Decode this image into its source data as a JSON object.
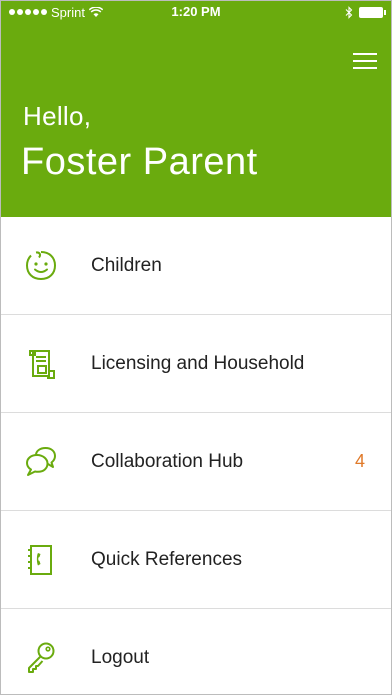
{
  "status_bar": {
    "carrier": "Sprint",
    "time": "1:20 PM"
  },
  "header": {
    "greeting": "Hello,",
    "name": "Foster Parent"
  },
  "menu": {
    "items": [
      {
        "label": "Children",
        "icon": "child-face-icon",
        "badge": ""
      },
      {
        "label": "Licensing and Household",
        "icon": "document-scroll-icon",
        "badge": ""
      },
      {
        "label": "Collaboration Hub",
        "icon": "chat-bubbles-icon",
        "badge": "4"
      },
      {
        "label": "Quick References",
        "icon": "phone-book-icon",
        "badge": ""
      },
      {
        "label": "Logout",
        "icon": "key-icon",
        "badge": ""
      }
    ]
  },
  "colors": {
    "brand_green": "#6aab0e",
    "icon_green": "#6aab0e",
    "badge_orange": "#e07a2a"
  }
}
